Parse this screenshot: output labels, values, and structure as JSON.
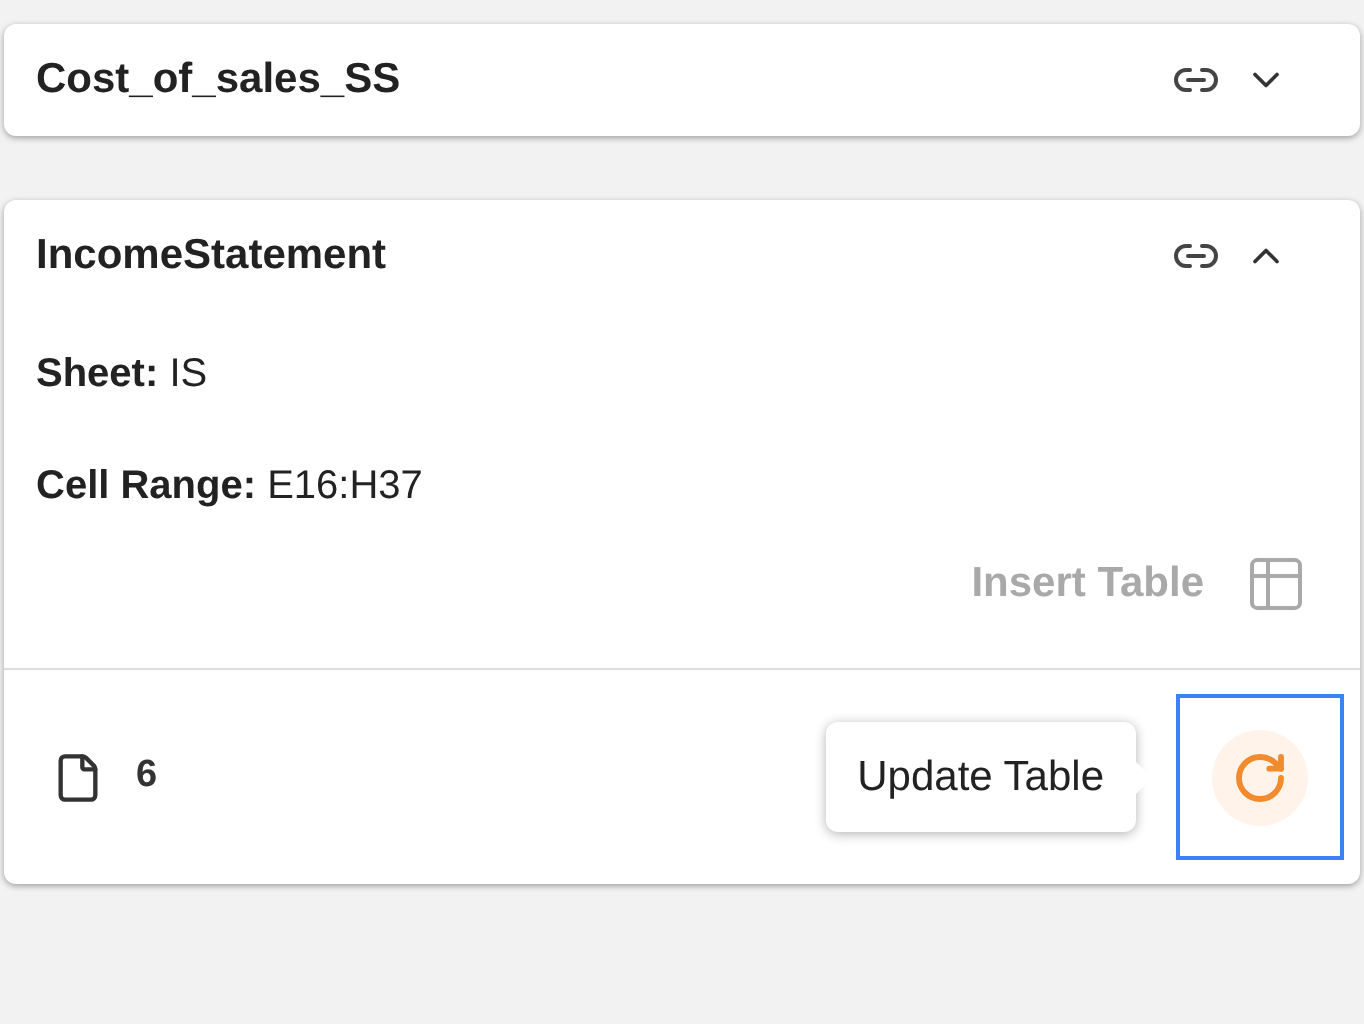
{
  "cards": [
    {
      "title": "Cost_of_sales_SS",
      "expanded": false
    },
    {
      "title": "IncomeStatement",
      "expanded": true,
      "fields": [
        {
          "label": "Sheet:",
          "value": "IS"
        },
        {
          "label": "Cell Range:",
          "value": "E16:H37"
        }
      ],
      "insert_action": "Insert Table",
      "page_count": "6",
      "tooltip": "Update Table",
      "update_focused": true
    }
  ]
}
